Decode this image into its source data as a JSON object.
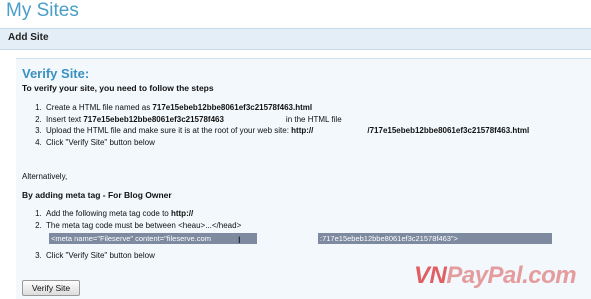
{
  "page_title": "My Sites",
  "section_title": "Add Site",
  "verify": {
    "title": "Verify Site:",
    "intro": "To verify your site, you need to follow the steps",
    "steps": [
      {
        "pre": "Create a HTML file named as ",
        "bold": "717e15ebeb12bbe8061ef3c21578f463.html",
        "post": ""
      },
      {
        "pre": "Insert text ",
        "bold": "717e15ebeb12bbe8061ef3c21578f463",
        "post": "in the HTML file"
      },
      {
        "pre": "Upload the HTML file and make sure it is at the root of your web site: ",
        "bold": "http://",
        "bold2": "/717e15ebeb12bbe8061ef3c21578f463.html"
      },
      {
        "text": "Click \"Verify Site\" button below"
      }
    ],
    "alternatively": "Alternatively,",
    "meta_heading": "By adding meta tag - For Blog Owner",
    "meta_steps": [
      {
        "pre": "Add the following meta tag code to ",
        "bold": "http://"
      },
      {
        "text": "The meta tag code must be between <heau>...</head>"
      }
    ],
    "meta_code_part1": "<meta name=\"Fileserve\" content=\"fileserve.com",
    "meta_code_part2": ":717e15ebeb12bbe8061ef3c21578f463\">",
    "final_step": "Click \"Verify Site\" button below",
    "button_label": "Verify Site"
  },
  "watermark": {
    "part1": "VN",
    "part2": "PayPal.com"
  }
}
